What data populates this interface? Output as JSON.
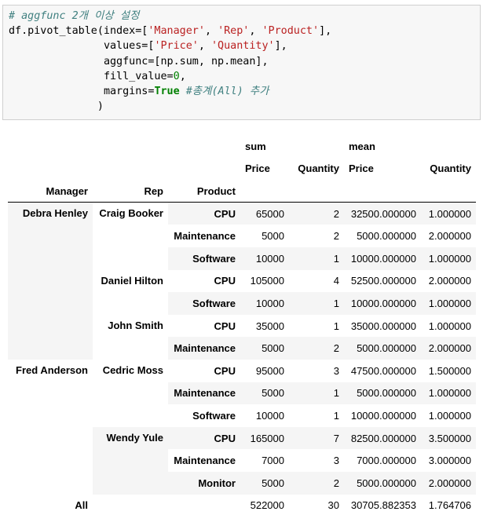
{
  "code": {
    "comment": "# aggfunc 2개 이상 설정",
    "l2_a": "df.pivot_table(index=[",
    "s_manager": "'Manager'",
    "comma1": ", ",
    "s_rep": "'Rep'",
    "comma2": ", ",
    "s_product": "'Product'",
    "l2_b": "],",
    "indent": "               ",
    "l3_a": "values=[",
    "s_price": "'Price'",
    "comma3": ", ",
    "s_quantity": "'Quantity'",
    "l3_b": "],",
    "l4": "aggfunc=[np.sum, np.mean],",
    "l5_a": "fill_value=",
    "l5_num": "0",
    "l5_b": ",",
    "l6_a": "margins=",
    "l6_kw": "True",
    "l6_comment": " #총계(All) 추가",
    "l7_indent": "              ",
    "l7": ")"
  },
  "table": {
    "top_headers": [
      "sum",
      "mean"
    ],
    "sub_headers": [
      "Price",
      "Quantity",
      "Price",
      "Quantity"
    ],
    "index_names": [
      "Manager",
      "Rep",
      "Product"
    ],
    "rows": [
      {
        "manager": "Debra Henley",
        "rep": "Craig Booker",
        "product": "CPU",
        "v": [
          "65000",
          "2",
          "32500.000000",
          "1.000000"
        ]
      },
      {
        "manager": "",
        "rep": "",
        "product": "Maintenance",
        "v": [
          "5000",
          "2",
          "5000.000000",
          "2.000000"
        ]
      },
      {
        "manager": "",
        "rep": "",
        "product": "Software",
        "v": [
          "10000",
          "1",
          "10000.000000",
          "1.000000"
        ]
      },
      {
        "manager": "",
        "rep": "Daniel Hilton",
        "product": "CPU",
        "v": [
          "105000",
          "4",
          "52500.000000",
          "2.000000"
        ]
      },
      {
        "manager": "",
        "rep": "",
        "product": "Software",
        "v": [
          "10000",
          "1",
          "10000.000000",
          "1.000000"
        ]
      },
      {
        "manager": "",
        "rep": "John Smith",
        "product": "CPU",
        "v": [
          "35000",
          "1",
          "35000.000000",
          "1.000000"
        ]
      },
      {
        "manager": "",
        "rep": "",
        "product": "Maintenance",
        "v": [
          "5000",
          "2",
          "5000.000000",
          "2.000000"
        ]
      },
      {
        "manager": "Fred Anderson",
        "rep": "Cedric Moss",
        "product": "CPU",
        "v": [
          "95000",
          "3",
          "47500.000000",
          "1.500000"
        ]
      },
      {
        "manager": "",
        "rep": "",
        "product": "Maintenance",
        "v": [
          "5000",
          "1",
          "5000.000000",
          "1.000000"
        ]
      },
      {
        "manager": "",
        "rep": "",
        "product": "Software",
        "v": [
          "10000",
          "1",
          "10000.000000",
          "1.000000"
        ]
      },
      {
        "manager": "",
        "rep": "Wendy Yule",
        "product": "CPU",
        "v": [
          "165000",
          "7",
          "82500.000000",
          "3.500000"
        ]
      },
      {
        "manager": "",
        "rep": "",
        "product": "Maintenance",
        "v": [
          "7000",
          "3",
          "7000.000000",
          "3.000000"
        ]
      },
      {
        "manager": "",
        "rep": "",
        "product": "Monitor",
        "v": [
          "5000",
          "2",
          "5000.000000",
          "2.000000"
        ]
      },
      {
        "manager": "All",
        "rep": "",
        "product": "",
        "v": [
          "522000",
          "30",
          "30705.882353",
          "1.764706"
        ]
      }
    ]
  }
}
